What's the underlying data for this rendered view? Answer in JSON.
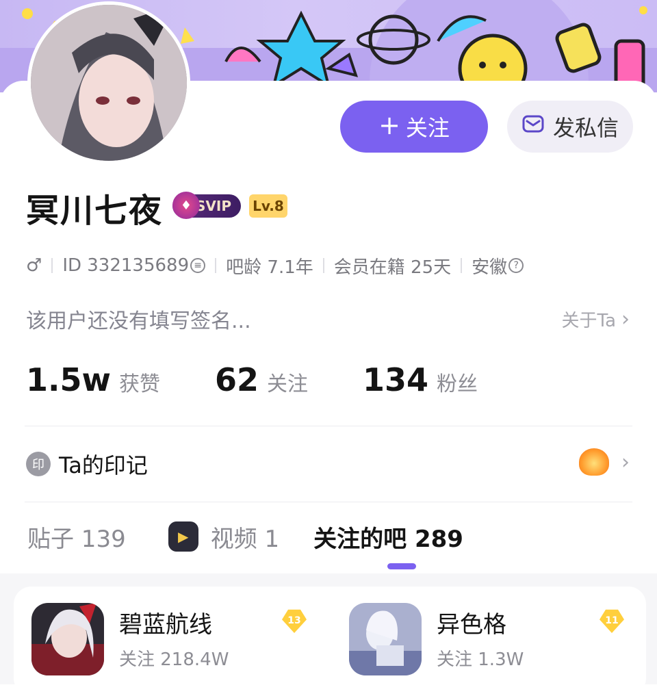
{
  "profile": {
    "name": "冥川七夜",
    "svip_label": "SVIP",
    "level_label": "Lv.8",
    "gender_symbol": "♂",
    "id_text": "ID 332135689",
    "bar_age": "吧龄 7.1年",
    "member_days": "会员在籍 25天",
    "location": "安徽",
    "signature": "该用户还没有填写签名...",
    "about_label": "关于Ta"
  },
  "actions": {
    "follow_label": "关注",
    "message_label": "发私信"
  },
  "stats": [
    {
      "value": "1.5w",
      "label": "获赞"
    },
    {
      "value": "62",
      "label": "关注"
    },
    {
      "value": "134",
      "label": "粉丝"
    }
  ],
  "marks": {
    "seal_char": "印",
    "label": "Ta的印记"
  },
  "tabs": [
    {
      "label": "贴子 139"
    },
    {
      "label": "视频 1"
    },
    {
      "label": "关注的吧 289"
    }
  ],
  "forums": [
    {
      "name": "碧蓝航线",
      "count": "关注 218.4W",
      "level": "13"
    },
    {
      "name": "异色格",
      "count": "关注 1.3W",
      "level": "11"
    }
  ],
  "colors": {
    "accent": "#7b61f0",
    "banner": "#c7b8f3"
  },
  "icons": {
    "message": "mail-icon",
    "about_chevron": "chevron-right-icon",
    "info": "question-circle-icon",
    "copy": "copy-icon"
  }
}
